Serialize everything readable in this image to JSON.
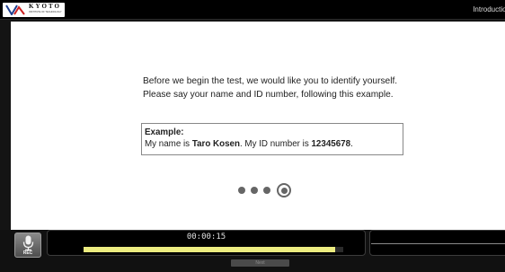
{
  "header": {
    "logo_word": "KYOTO",
    "logo_sub": "INSTITUTE OF TECHNOLOGY",
    "section_title": "Introduction"
  },
  "instructions": {
    "line1": "Before we begin the test, we would like you to identify yourself.",
    "line2": "Please say your name and ID number, following this example."
  },
  "example": {
    "heading": "Example:",
    "part1": "My name is ",
    "name": "Taro Kosen",
    "part2": ". My ID number is ",
    "id_number": "12345678",
    "part3": "."
  },
  "steps": {
    "total": 4,
    "current": 4
  },
  "recorder": {
    "rec_label": "REC",
    "timer": "00:00:15",
    "progress": 0.97,
    "progress_color": "#ecec80"
  },
  "footer": {
    "next_label": "Next"
  }
}
